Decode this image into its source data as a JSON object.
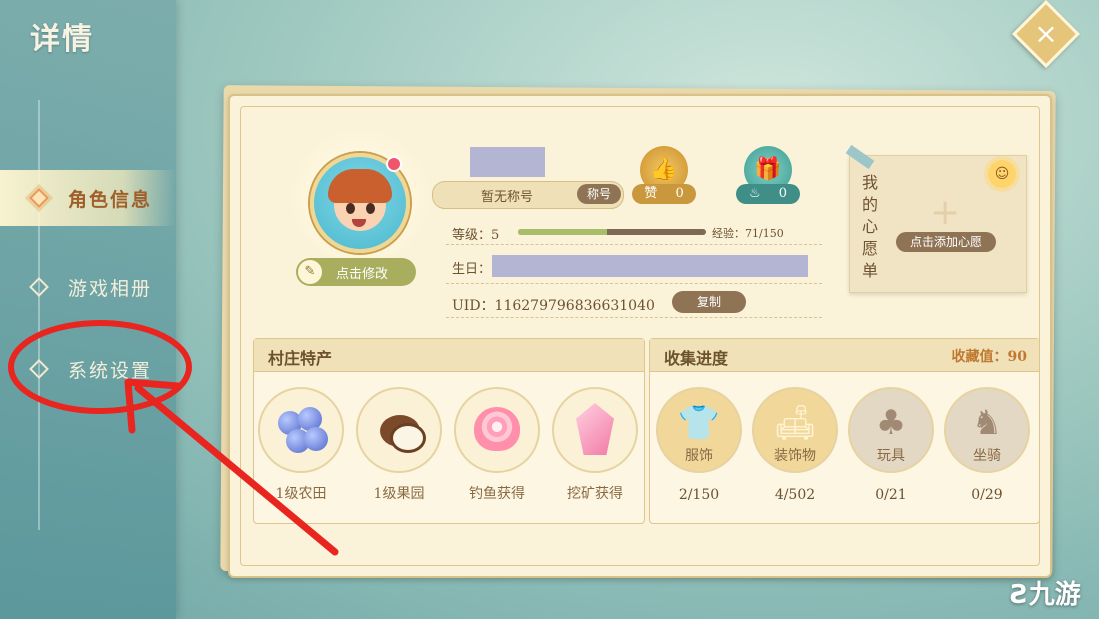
{
  "page_title": "详情",
  "close_icon": "×",
  "sidebar": {
    "items": [
      {
        "label": "角色信息",
        "active": true
      },
      {
        "label": "游戏相册",
        "active": false
      },
      {
        "label": "系统设置",
        "active": false
      }
    ]
  },
  "profile": {
    "edit_avatar_label": "点击修改",
    "title_text": "暂无称号",
    "title_button": "称号",
    "level_label": "等级：5",
    "exp_text": "经验：71/150",
    "exp_progress": 0.473,
    "birthday_label": "生日：",
    "uid_text": "UID：116279796836631040",
    "copy_button": "复制"
  },
  "badges": {
    "likes": {
      "label": "赞",
      "count": "0",
      "color": "#d9a94a"
    },
    "gifts": {
      "label": "",
      "count": "0",
      "color": "#4fa8a0"
    }
  },
  "wishlist": {
    "title": "我的心愿单",
    "add_button": "点击添加心愿"
  },
  "village": {
    "title": "村庄特产",
    "items": [
      {
        "label": "1级农田",
        "icon": "blueberry-icon"
      },
      {
        "label": "1级果园",
        "icon": "coconut-icon"
      },
      {
        "label": "钓鱼获得",
        "icon": "shell-icon"
      },
      {
        "label": "挖矿获得",
        "icon": "crystal-icon"
      }
    ]
  },
  "collection": {
    "title": "收集进度",
    "score": "收藏值：90",
    "items": [
      {
        "label": "服饰",
        "value": "2/150",
        "icon": "shirt-icon",
        "active": true
      },
      {
        "label": "装饰物",
        "value": "4/502",
        "icon": "sofa-icon",
        "active": true
      },
      {
        "label": "玩具",
        "value": "0/21",
        "icon": "clover-icon",
        "active": false
      },
      {
        "label": "坐骑",
        "value": "0/29",
        "icon": "horse-icon",
        "active": false
      }
    ]
  },
  "watermark": "九游",
  "colors": {
    "accent": "#e5c57a",
    "text": "#6d5230",
    "annotation": "#e8261f"
  }
}
